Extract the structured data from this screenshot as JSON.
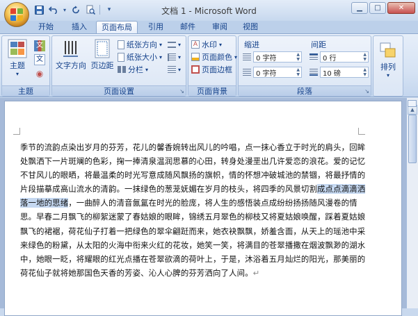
{
  "window": {
    "title": "文档 1 - Microsoft Word",
    "controls": {
      "minimize": "▁",
      "maximize": "□",
      "close": "✕"
    }
  },
  "qat": {
    "customize": "▾"
  },
  "tabs": [
    {
      "label": "开始"
    },
    {
      "label": "插入"
    },
    {
      "label": "页面布局"
    },
    {
      "label": "引用"
    },
    {
      "label": "邮件"
    },
    {
      "label": "审阅"
    },
    {
      "label": "视图"
    }
  ],
  "ribbon": {
    "theme": {
      "label": "主题",
      "btn": "主题",
      "colors_icon": "文",
      "fonts_icon": "文",
      "effects_icon": "◉",
      "arrow": "▾"
    },
    "page_setup": {
      "label": "页面设置",
      "text_direction": "文字方向",
      "margins": "页边距",
      "orientation": "纸张方向",
      "size": "纸张大小",
      "columns": "分栏",
      "arrow": "▾"
    },
    "page_background": {
      "label": "页面背景",
      "watermark": "水印",
      "page_color": "页面颜色",
      "page_borders": "页面边框"
    },
    "paragraph": {
      "label": "段落",
      "indent_head": "缩进",
      "spacing_head": "间距",
      "indent_left": "0 字符",
      "indent_right": "0 字符",
      "spacing_before": "0 行",
      "spacing_after": "10 磅"
    },
    "arrange": {
      "label": "排列"
    }
  },
  "document": {
    "text_before": "季节的流韵点染出岁月的芬芳，花儿的馨香婉转出风儿的吟唱，点一抹心香立于时光的肩头，回眸处飘洒下一片斑斓的色彩，掬一捧清泉温润思慕的心田，转身处漫垩出几许爱恋的浪花。爱的记忆不甘风儿的眼晒，将最温柔的时光写意成随风飘扬的旗帜，情的怀想冲破城池的禁锢，将最抒情的片段描摹成高山流水的清韵。一抹绿色的葱茏妩媚在岁月的枝头，将四季的风景切割",
    "selected": "成点点滴滴洒落一地的思绪",
    "text_after": "，一曲醉人的清音氤氲在时光的脸庞，将人生的感悟装点成纷纷扬扬随风漫卷的情思。早春二月飘飞的柳絮迷蒙了春姑娘的眼眸，锦绣五月翠色的柳枝又将夏姑娘唤醒，踩着夏姑娘飘飞的裙裾，荷花仙子打着一把绿色的翠伞翩跹而来，她衣袂飘飘，娇羞含面，从天上的瑶池中采来绿色的粉黛，从太阳的火海中衔来火红的花妆，她笑一笑，将满目的苍翠播撒在烟波飘渺的湖水中，她眼一眨，将耀眼的红光点播在苍翠欲滴的荷叶上，于是，沐浴着五月灿烂的阳光，那美丽的荷花仙子就将她那国色天香的芳姿、沁人心脾的芬芳洒向了人间。",
    "para_mark": "↵"
  },
  "colors": {
    "accent": "#15428b",
    "selection": "#c5d8f1"
  }
}
